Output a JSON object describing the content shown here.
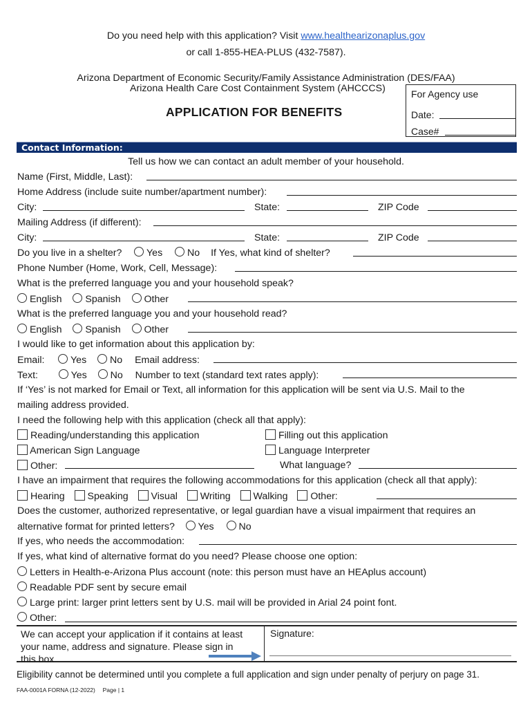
{
  "help": {
    "line1_prefix": "Do you need help with this application? Visit ",
    "link": "www.healthearizonaplus.gov",
    "line2": "or call 1-855-HEA-PLUS (432-7587)."
  },
  "agencies": {
    "line1": "Arizona Department of Economic Security/Family Assistance Administration (DES/FAA)",
    "line2": "Arizona Health Care Cost Containment System (AHCCCS)"
  },
  "title": "APPLICATION FOR BENEFITS",
  "agency_box": {
    "heading": "For Agency use",
    "date_label": "Date:",
    "case_label": "Case#"
  },
  "section": {
    "header": "Contact Information:",
    "intro": "Tell us how we can contact an adult member of your household."
  },
  "fields": {
    "name": "Name (First, Middle, Last):",
    "home_address": "Home Address (include suite number/apartment number):",
    "city": "City:",
    "state": "State:",
    "zip": "ZIP Code",
    "mailing_address": "Mailing Address (if different):",
    "city2": "City:",
    "state2": "State:",
    "zip2": "ZIP Code",
    "shelter_q": "Do you live in a shelter?",
    "yes": "Yes",
    "no": "No",
    "shelter_kind": "If Yes, what kind of shelter?",
    "phone": "Phone Number (Home, Work, Cell, Message):"
  },
  "language": {
    "speak_q": "What is the preferred language you and your household speak?",
    "read_q": "What is the preferred language you and your household read?",
    "options": [
      "English",
      "Spanish",
      "Other"
    ]
  },
  "contact_pref": {
    "q": "I would like to get information about this application by:",
    "email_label": "Email:",
    "email_address": "Email address:",
    "text_label": "Text:",
    "text_number": "Number to text (standard text rates apply):",
    "yes": "Yes",
    "no": "No",
    "note_line1": "If ‘Yes’ is not marked for Email or Text, all information for this application will be sent via U.S. Mail to the",
    "note_line2": "mailing address provided."
  },
  "help_needed": {
    "q": "I need the following help with this application (check all that apply):",
    "options": [
      "Reading/understanding this application",
      "Filling out this application",
      "American Sign Language",
      "Language Interpreter",
      "Other:"
    ],
    "what_language": "What language?"
  },
  "impairment": {
    "q": "I have an impairment that requires the following accommodations for this application (check all that apply):",
    "options": [
      "Hearing",
      "Speaking",
      "Visual",
      "Writing",
      "Walking",
      "Other:"
    ]
  },
  "visual": {
    "q_line1": "Does the customer, authorized representative, or legal guardian have a visual impairment that requires an",
    "q_line2": "alternative format for printed letters?",
    "yes": "Yes",
    "no": "No",
    "who": "If yes, who needs the accommodation:",
    "format_q": "If yes, what kind of alternative format do you need? Please choose one option:",
    "formats": [
      "Letters in Health-e-Arizona Plus account (note: this person must have an HEAplus account)",
      "Readable PDF sent by secure email",
      "Large print: larger print letters sent by U.S. mail will be provided in Arial 24 point font.",
      "Other:"
    ]
  },
  "signature": {
    "note_line1": "We can accept your application if it contains at least",
    "note_line2": "your name, address and signature. Please sign in",
    "note_line3": "this box",
    "label": "Signature:",
    "arrow_color": "#4f81bd"
  },
  "footer": {
    "eligibility": "Eligibility cannot be determined until you complete a full application and sign under penalty of perjury on page 31.",
    "form_id": "FAA-0001A FORNA (12-2022)",
    "page": "Page | 1"
  }
}
